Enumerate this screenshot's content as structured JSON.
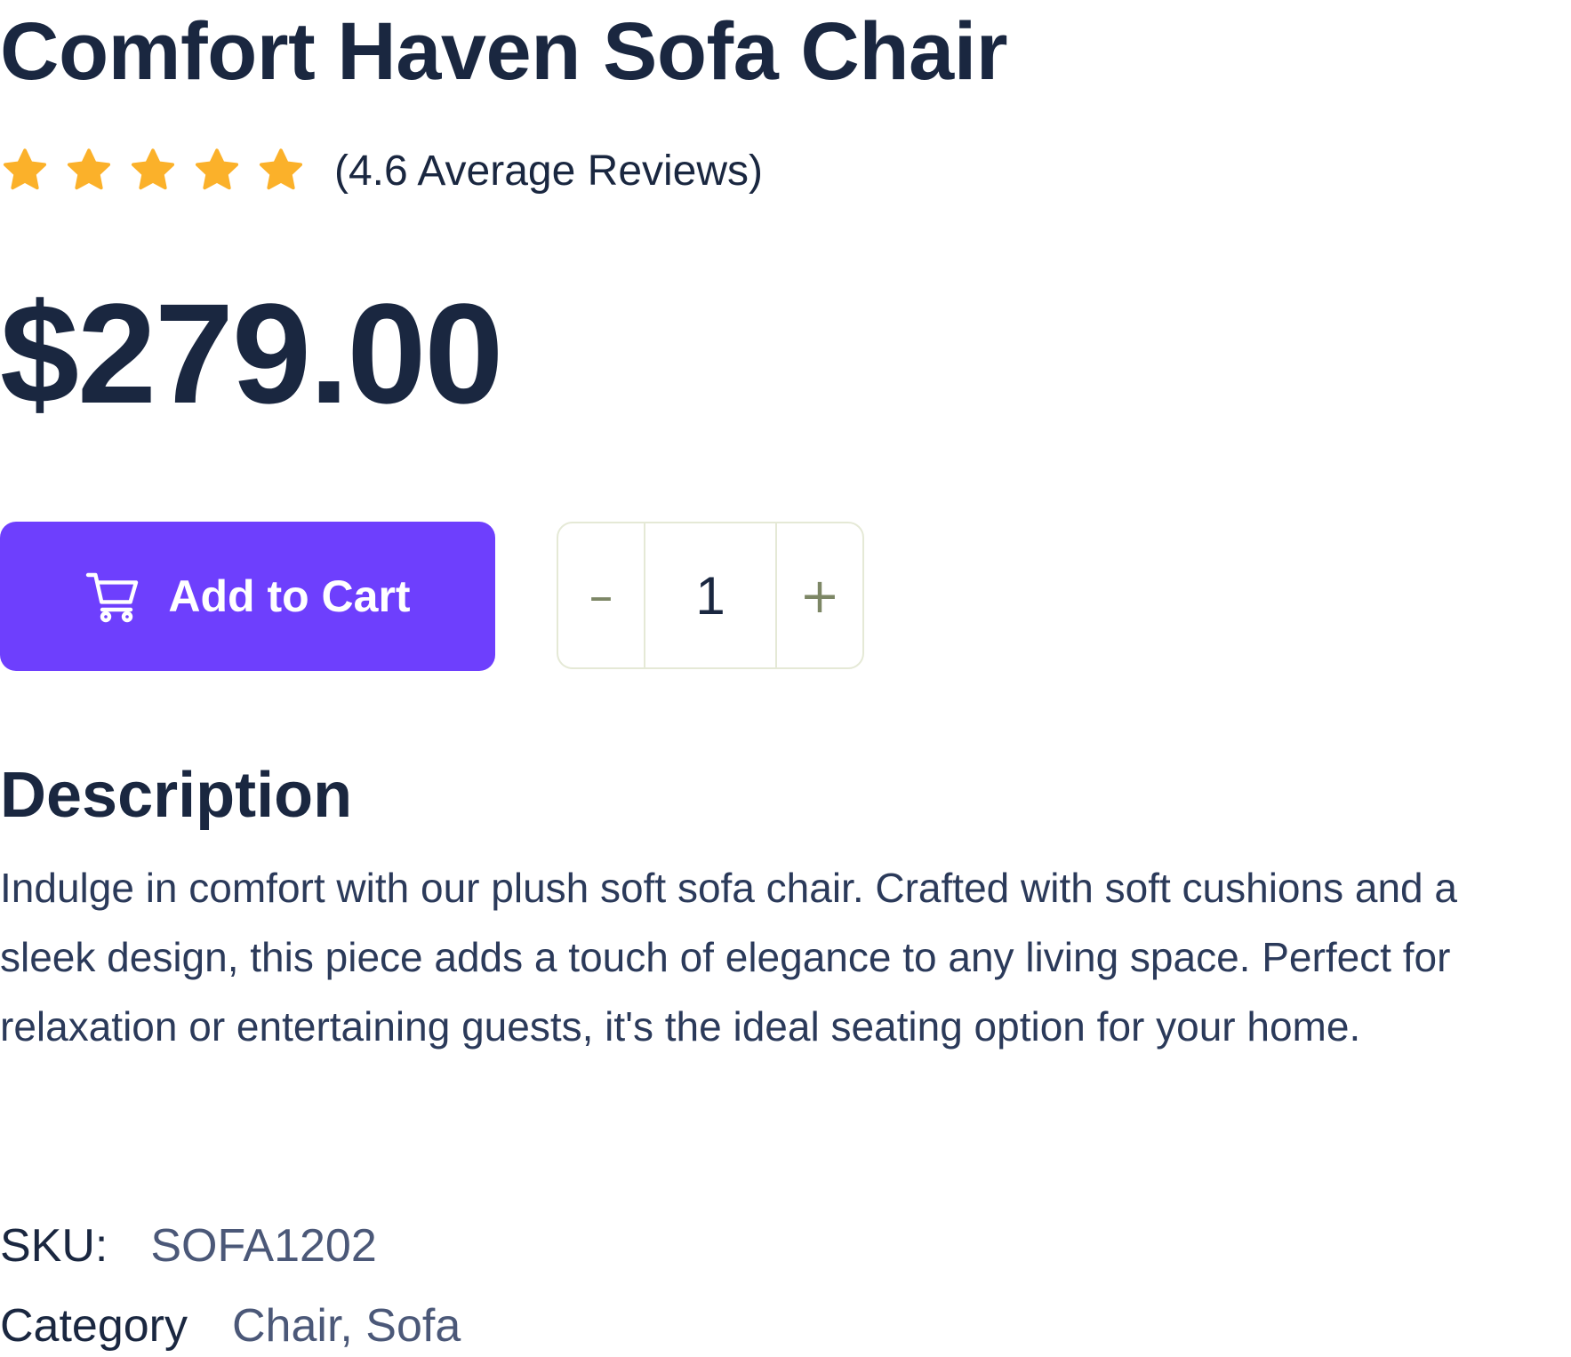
{
  "product": {
    "title": "Comfort Haven Sofa Chair",
    "rating": {
      "stars": 5,
      "text": "(4.6 Average Reviews)",
      "star_color": "#fbb12a"
    },
    "price": "$279.00",
    "cart": {
      "label": "Add to Cart",
      "icon": "cart-icon",
      "background_color": "#6e3ffd"
    },
    "quantity": {
      "decrement_label": "–",
      "value": "1",
      "increment_label": "+"
    },
    "description": {
      "heading": "Description",
      "body": "Indulge in comfort with our plush soft sofa chair. Crafted with soft cushions and a sleek design, this piece adds a touch of elegance to any living space. Perfect for relaxation or entertaining guests, it's the ideal seating option for your home."
    },
    "meta": {
      "sku_label": "SKU:",
      "sku_value": "SOFA1202",
      "category_label": "Category",
      "category_value": "Chair, Sofa"
    }
  }
}
